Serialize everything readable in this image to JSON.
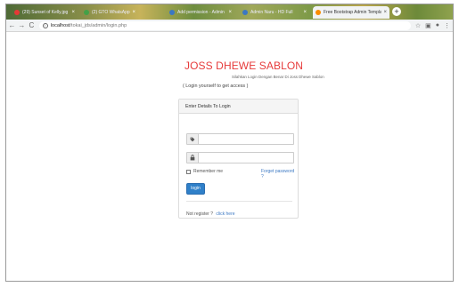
{
  "browser": {
    "tabs": [
      {
        "title": "(29) Sunset of Kelly.jpg",
        "favicon_color": "#e53935",
        "active": false
      },
      {
        "title": "(2) GTO WhatsApp",
        "favicon_color": "#43a047",
        "active": false
      },
      {
        "title": "Add permission - Admin",
        "favicon_color": "#3b78c3",
        "active": false
      },
      {
        "title": "Admin Naru - HD Full",
        "favicon_color": "#3b78c3",
        "active": false
      },
      {
        "title": "Free Bootstrap Admin Templa",
        "favicon_color": "#fb8c00",
        "active": true
      }
    ],
    "new_tab_label": "+",
    "tab_close_glyph": "×",
    "back_glyph": "←",
    "forward_glyph": "→",
    "reload_glyph": "C",
    "info_glyph": "i",
    "url_host": "localhost",
    "url_path": "/tokai_jds/admin/login.php",
    "star_glyph": "☆",
    "ext_glyph": "▣",
    "profile_glyph": "●",
    "menu_glyph": "⋮"
  },
  "login": {
    "brand": "JOSS DHEWE SABLON",
    "subtitle": "Silahkan Login Dengan Benar Di Joss Dhewe Sablon",
    "lead": "( Login yourself to get access )",
    "panel_title": "Enter Details To Login",
    "username_icon": "tag-icon",
    "password_icon": "lock-icon",
    "remember_label": "Remember me",
    "forgot_label": "Forget password ?",
    "button_label": "login",
    "register_prefix": "Not register ?",
    "register_link": "click here"
  },
  "colors": {
    "brand": "#e63b3b",
    "link": "#3b78c3",
    "button": "#2f80c9"
  }
}
